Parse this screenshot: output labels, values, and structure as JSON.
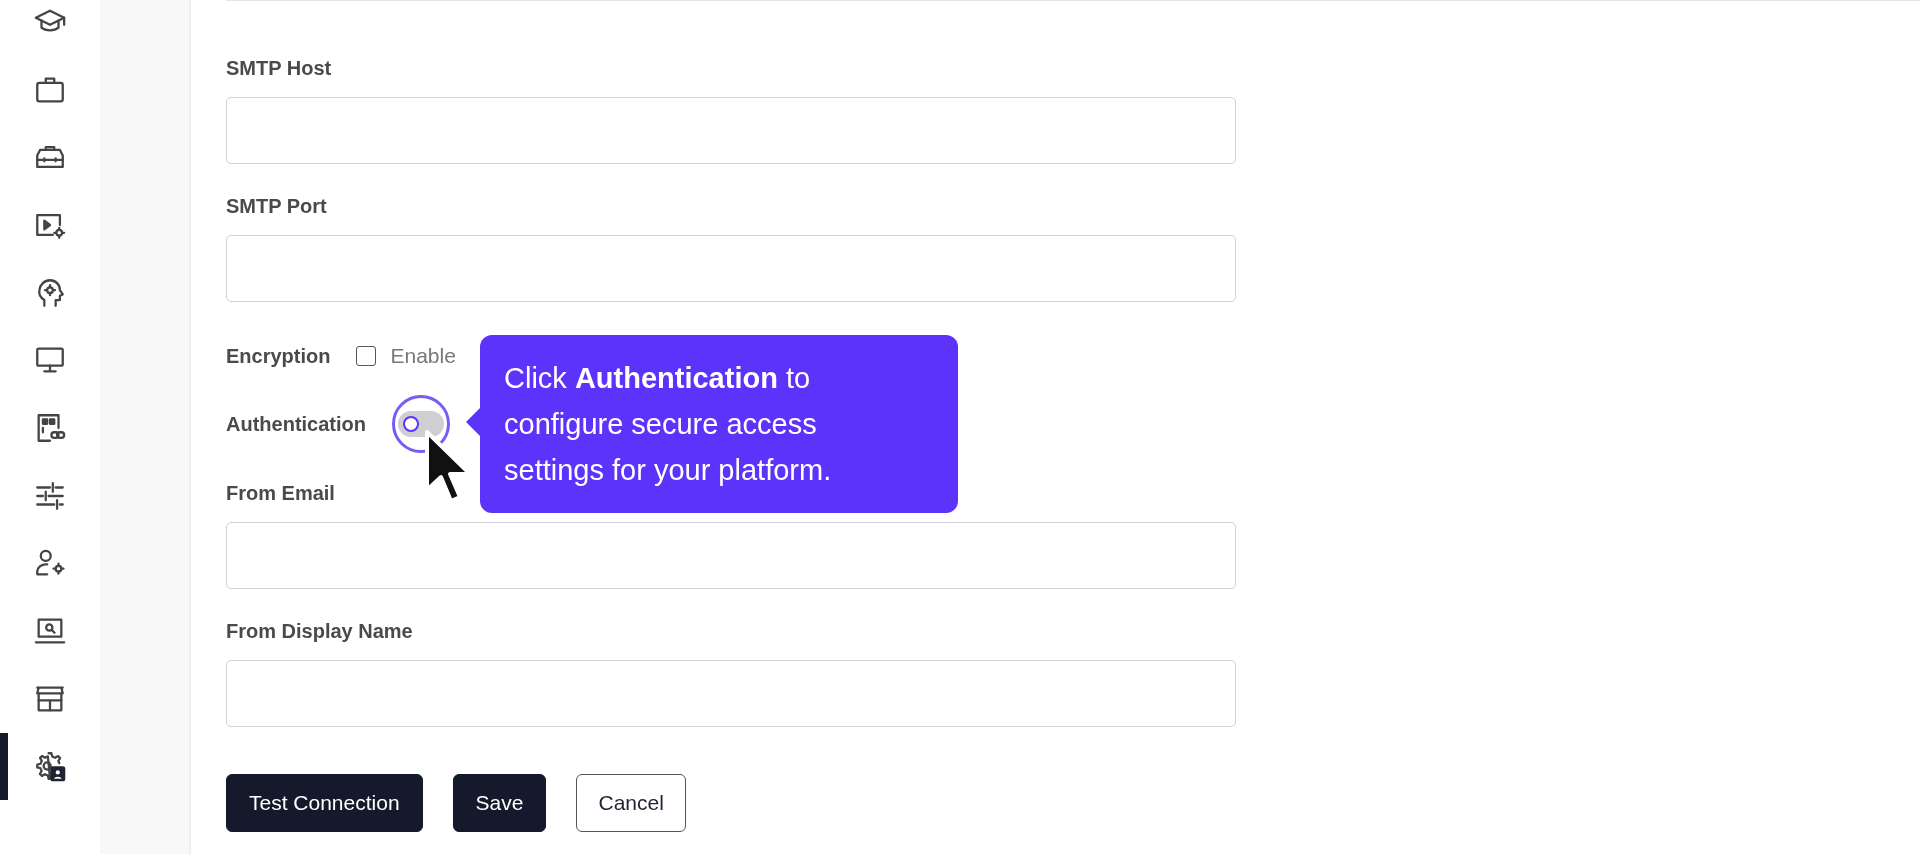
{
  "sidebar": {
    "items": [
      {
        "selected": false
      },
      {
        "selected": false
      },
      {
        "selected": false
      },
      {
        "selected": false
      },
      {
        "selected": false
      },
      {
        "selected": false
      },
      {
        "selected": false
      },
      {
        "selected": false
      },
      {
        "selected": false
      },
      {
        "selected": false
      },
      {
        "selected": false
      },
      {
        "selected": true
      }
    ]
  },
  "form": {
    "fields": [
      {
        "kind": "text",
        "label": "SMTP Host"
      },
      {
        "kind": "text",
        "label": "SMTP Port"
      },
      {
        "kind": "checkbox",
        "label": "Encryption",
        "option": "Enable",
        "checked": false
      },
      {
        "kind": "toggle",
        "label": "Authentication",
        "on": false
      },
      {
        "kind": "text",
        "label": "From Email"
      },
      {
        "kind": "text",
        "label": "From Display Name"
      }
    ],
    "buttons": [
      {
        "kind": "primary",
        "label": "Test Connection"
      },
      {
        "kind": "primary",
        "label": "Save"
      },
      {
        "kind": "secondary",
        "label": "Cancel"
      }
    ]
  },
  "tooltip": {
    "text": "Click **Authentication** to configure secure access settings for your platform."
  }
}
